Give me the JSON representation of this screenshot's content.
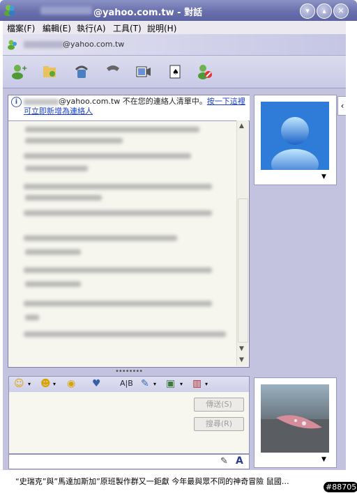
{
  "window": {
    "title": "@yahoo.com.tw - 對話",
    "buttons": [
      "▾",
      "▴",
      "✕"
    ]
  },
  "menu": [
    "檔案(F)",
    "編輯(E)",
    "執行(A)",
    "工具(T)",
    "說明(H)"
  ],
  "header": {
    "contact": "@yahoo.com.tw"
  },
  "toolbar": [
    "add-contact-icon",
    "share-files-icon",
    "voice-call-icon",
    "phone-icon",
    "video-icon",
    "games-icon",
    "block-contact-icon"
  ],
  "notice": {
    "address": "@yahoo.com.tw",
    "text": " 不在您的連絡人清單中。",
    "link": "按一下這裡可立即新增為連絡人"
  },
  "format": {
    "font_label": "A",
    "text_format_label": "A"
  },
  "buttons": {
    "send": "傳送(S)",
    "search": "搜尋(R)"
  },
  "status": {
    "text": "“史瑞克”與”馬達加斯加”原班製作群又一鉅獻 今年最與眾不同的神奇冒險 鼠國…",
    "badge": "#88705"
  },
  "colors": {
    "titlebar": "#6c72ae",
    "link": "#1b3fd0"
  }
}
